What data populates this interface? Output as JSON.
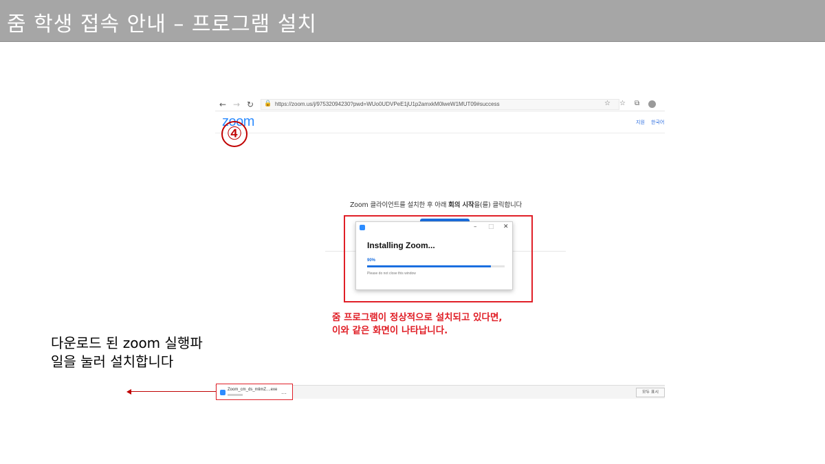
{
  "slide": {
    "title": "줌 학생 접속 안내 – 프로그램 설치"
  },
  "browser": {
    "url": "https://zoom.us/j/97532094230?pwd=WUo0UDVPeE1jU1p2amxkM0lweW1MUT09#success",
    "logo": "zoom",
    "header_links": [
      "지원",
      "한국어"
    ],
    "icons": {
      "back": "←",
      "forward": "→",
      "reload": "↻",
      "lock": "🔒",
      "favorite": "☆",
      "collections": "☆",
      "extensions": "⧉"
    }
  },
  "step": {
    "number": "④"
  },
  "instruction": {
    "before": "Zoom 클라이언트를 설치한 후 아래 ",
    "bold": "회의 시작",
    "after": "을(를) 클릭합니다"
  },
  "installer": {
    "title": "Installing Zoom...",
    "progress_label": "90%",
    "progress_value": 0.9,
    "note": "Please do not close this window",
    "controls": {
      "minimize": "–",
      "maximize": "□",
      "close": "✕"
    }
  },
  "caption": {
    "line1": "줌 프로그램이 정상적으로 설치되고 있다면,",
    "line2": "이와 같은 화면이 나타납니다."
  },
  "download": {
    "file_name": "Zoom_cm_ds_mlimZ....exe",
    "more": "…",
    "show_all": "모두 표시"
  },
  "side_note": {
    "text": "다운로드 된 zoom 실행파일을 눌러 설치합니다"
  },
  "colors": {
    "header_bg": "#a6a6a6",
    "accent_red": "#e01e26",
    "zoom_blue": "#2d8cff",
    "progress_blue": "#1a6fe0"
  }
}
